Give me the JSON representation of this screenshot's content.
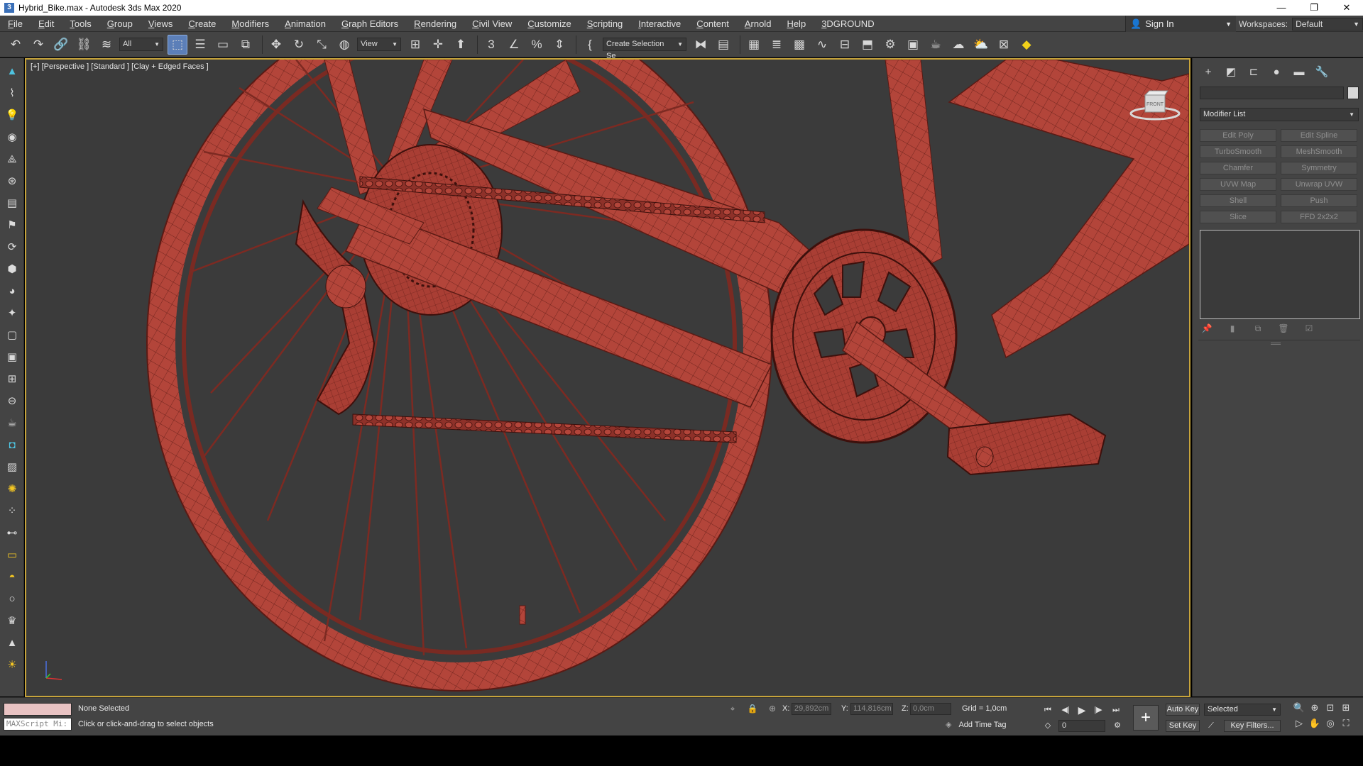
{
  "window": {
    "title": "Hybrid_Bike.max - Autodesk 3ds Max 2020",
    "controls": [
      "—",
      "❐",
      "✕"
    ]
  },
  "menu": [
    "File",
    "Edit",
    "Tools",
    "Group",
    "Views",
    "Create",
    "Modifiers",
    "Animation",
    "Graph Editors",
    "Rendering",
    "Civil View",
    "Customize",
    "Scripting",
    "Interactive",
    "Content",
    "Arnold",
    "Help",
    "3DGROUND"
  ],
  "signin": {
    "label": "Sign In"
  },
  "workspace": {
    "label": "Workspaces:",
    "value": "Default"
  },
  "toolbar": {
    "selection_filter": "All",
    "ref_coord": "View",
    "named_selection": "Create Selection Se",
    "icons": [
      "undo-icon",
      "redo-icon",
      "link-icon",
      "unlink-icon",
      "bind-spacewarp-icon",
      "select-object-icon",
      "select-by-name-icon",
      "rect-region-icon",
      "window-crossing-icon",
      "move-icon",
      "rotate-icon",
      "scale-icon",
      "placement-icon",
      "pivot-icon",
      "snap-3d-icon",
      "angle-snap-icon",
      "percent-snap-icon",
      "spinner-snap-icon",
      "edit-named-selections-icon",
      "mirror-icon",
      "align-icon",
      "toggle-scene-explorer-icon",
      "toggle-layer-explorer-icon",
      "toggle-ribbon-icon",
      "curve-editor-icon",
      "schematic-view-icon",
      "material-editor-icon",
      "render-setup-icon",
      "rendered-frame-window-icon",
      "render-production-icon",
      "render-activeshade-icon",
      "render-in-cloud-icon",
      "autodesk-a360-icon"
    ]
  },
  "viewport": {
    "label": "[+] [Perspective ] [Standard ] [Clay + Edged Faces ]",
    "viewcube_face": "FRONT",
    "model_color": "#b3453a",
    "wire_color": "#5a1a14",
    "bg_color": "#3b3b3b"
  },
  "command_panel": {
    "tabs": [
      "create-tab",
      "modify-tab",
      "hierarchy-tab",
      "motion-tab",
      "display-tab",
      "utilities-tab"
    ],
    "modifier_list": "Modifier List",
    "modifier_buttons": [
      "Edit Poly",
      "Edit Spline",
      "TurboSmooth",
      "MeshSmooth",
      "Chamfer",
      "Symmetry",
      "UVW Map",
      "Unwrap UVW",
      "Shell",
      "Push",
      "Slice",
      "FFD 2x2x2"
    ]
  },
  "status": {
    "maxscript": "MAXScript Mi:",
    "selection": "None Selected",
    "prompt": "Click or click-and-drag to select objects",
    "x_label": "X:",
    "x_value": "29,892cm",
    "y_label": "Y:",
    "y_value": "114,816cm",
    "z_label": "Z:",
    "z_value": "0,0cm",
    "grid": "Grid = 1,0cm",
    "add_time_tag": "Add Time Tag"
  },
  "animation": {
    "current_frame": "0",
    "auto_key": "Auto Key",
    "set_key": "Set Key",
    "key_mode": "Selected",
    "key_filters": "Key Filters..."
  }
}
